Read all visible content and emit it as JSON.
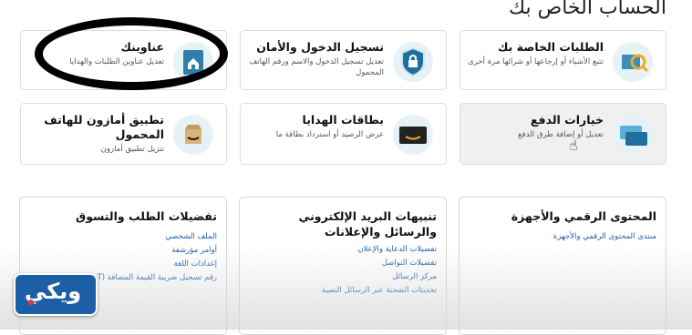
{
  "heading": "الحساب الخاص بك",
  "cards": [
    {
      "title": "الطلبات الخاصة بك",
      "desc": "تتبع الأشياء أو إرجاعها أو شرائها مرة أخرى",
      "icon": "orders-box-icon"
    },
    {
      "title": "تسجيل الدخول والأمان",
      "desc": "تعديل تسجيل الدخول والاسم ورقم الهاتف المحمول",
      "icon": "security-shield-icon"
    },
    {
      "title": "عناوينك",
      "desc": "تعديل عناوين الطلبات والهدايا",
      "icon": "address-book-icon"
    },
    {
      "title": "خيارات الدفع",
      "desc": "تعديل أو إضافة طرق الدفع",
      "icon": "payment-cards-icon"
    },
    {
      "title": "بطاقات الهدايا",
      "desc": "عرض الرصيد أو استرداد بطاقة ما",
      "icon": "gift-card-icon"
    },
    {
      "title": "تطبيق أمازون للهاتف المحمول",
      "desc": "تنزيل تطبيق أمازون",
      "icon": "amazon-app-icon"
    }
  ],
  "sections": [
    {
      "title": "المحتوى الرقمي والأجهزة",
      "links": [
        "منتدى المحتوى الرقمي والأجهزة"
      ]
    },
    {
      "title": "تنبيهات البريد الإلكتروني والرسائل والإعلانات",
      "links": [
        "تفضيلات الدعاية والإعلان",
        "تفضيلات التواصل",
        "مركز الرسائل",
        "تحديثات الشحنة عبر الرسائل النصية"
      ]
    },
    {
      "title": "تفضيلات الطلب والتسوق",
      "links": [
        "الملف الشخصي",
        "أوامر مؤرشفة",
        "إعدادات اللغة",
        "رقم تسجيل ضريبة القيمة المضافة (T"
      ]
    }
  ],
  "logo": "ويكي"
}
